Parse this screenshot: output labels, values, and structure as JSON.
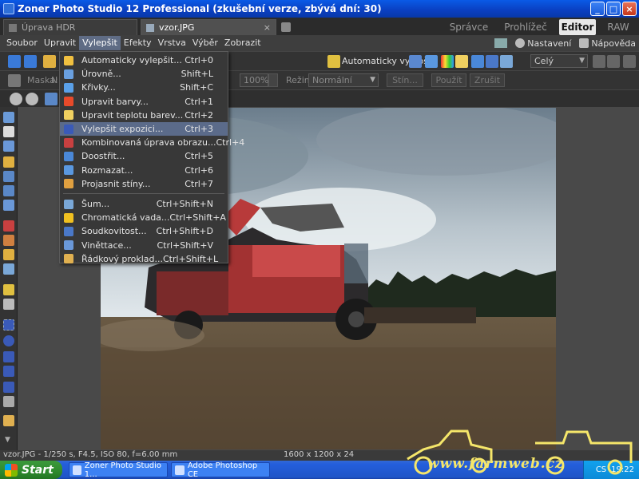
{
  "window": {
    "title": "Zoner Photo Studio 12 Professional (zkušební verze, zbývá dní: 30)"
  },
  "tabs": {
    "documents": [
      {
        "label": "Úprava HDR",
        "active": false
      },
      {
        "label": "vzor.JPG",
        "active": true
      }
    ],
    "modes": [
      {
        "label": "Správce",
        "active": false
      },
      {
        "label": "Prohlížeč",
        "active": false
      },
      {
        "label": "Editor",
        "active": true
      },
      {
        "label": "RAW",
        "active": false
      }
    ]
  },
  "menubar": {
    "items": [
      "Soubor",
      "Upravit",
      "Vylepšit",
      "Efekty",
      "Vrstva",
      "Výběr",
      "Zobrazit"
    ],
    "active": "Vylepšit",
    "right": {
      "settings": "Nastavení",
      "help": "Nápověda"
    }
  },
  "toolbar1": {
    "auto_enhance": "Automaticky vylepšit",
    "view_select": "Celý"
  },
  "toolbar2": {
    "mask_label": "Maska:",
    "mask_value": "N",
    "opacity": "100%",
    "mode_label": "Režim:",
    "mode_value": "Normální",
    "btn_stin": "Stín...",
    "btn_pouzit": "Použít",
    "btn_zrusit": "Zrušit"
  },
  "dropdown": {
    "items": [
      {
        "label": "Automaticky vylepšit...",
        "shortcut": "Ctrl+0",
        "icon": "auto-enhance-icon",
        "color": "#f0c040"
      },
      {
        "label": "Úrovně...",
        "shortcut": "Shift+L",
        "icon": "levels-icon",
        "color": "#6aa0e0"
      },
      {
        "label": "Křivky...",
        "shortcut": "Shift+C",
        "icon": "curves-icon",
        "color": "#5aa0e8"
      },
      {
        "label": "Upravit barvy...",
        "shortcut": "Ctrl+1",
        "icon": "rainbow-icon",
        "color": "#e84a2a"
      },
      {
        "label": "Upravit teplotu barev...",
        "shortcut": "Ctrl+2",
        "icon": "bulb-icon",
        "color": "#f0d060"
      },
      {
        "label": "Vylepšit expozici...",
        "shortcut": "Ctrl+3",
        "icon": "exposure-icon",
        "color": "#3a5ab8",
        "highlighted": true
      },
      {
        "label": "Kombinovaná úprava obrazu...",
        "shortcut": "Ctrl+4",
        "icon": "combined-icon",
        "color": "#c84040"
      },
      {
        "label": "Doostřit...",
        "shortcut": "Ctrl+5",
        "icon": "sharpen-icon",
        "color": "#4a88d8"
      },
      {
        "label": "Rozmazat...",
        "shortcut": "Ctrl+6",
        "icon": "blur-icon",
        "color": "#5a98e0"
      },
      {
        "label": "Projasnit stíny...",
        "shortcut": "Ctrl+7",
        "icon": "shadows-icon",
        "color": "#e0a040"
      },
      {
        "label": "Šum...",
        "shortcut": "Ctrl+Shift+N",
        "icon": "noise-icon",
        "color": "#7aa8d8"
      },
      {
        "label": "Chromatická vada...",
        "shortcut": "Ctrl+Shift+A",
        "icon": "star-icon",
        "color": "#f0c020"
      },
      {
        "label": "Soudkovitost...",
        "shortcut": "Ctrl+Shift+D",
        "icon": "barrel-icon",
        "color": "#4a78c8"
      },
      {
        "label": "Viněttace...",
        "shortcut": "Ctrl+Shift+V",
        "icon": "vignette-icon",
        "color": "#6a98d8"
      },
      {
        "label": "Řádkový proklad...",
        "shortcut": "Ctrl+Shift+L",
        "icon": "interlace-icon",
        "color": "#e0b050"
      }
    ]
  },
  "statusbar": {
    "exif": "vzor.JPG - 1/250 s, F4.5, ISO 80, f=6.00 mm",
    "dimensions": "1600 x 1200 x 24"
  },
  "taskbar": {
    "start": "Start",
    "items": [
      "Zoner Photo Studio 1...",
      "Adobe Photoshop CE"
    ],
    "lang": "CS",
    "time": "19:22"
  },
  "watermark": {
    "text": "www.farmweb.cz"
  }
}
